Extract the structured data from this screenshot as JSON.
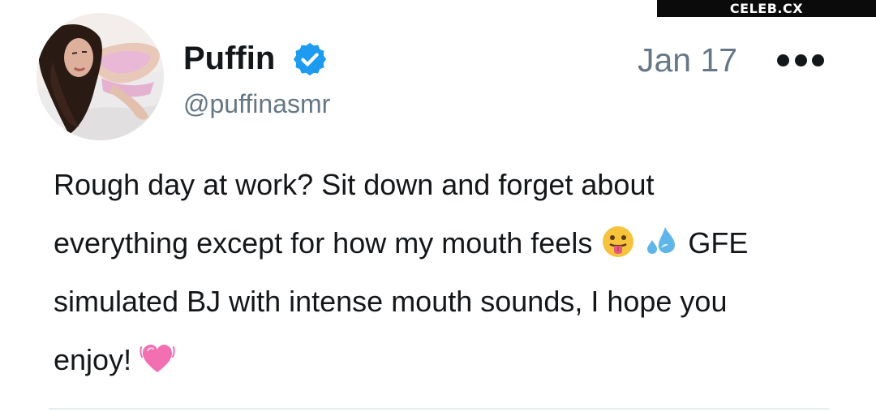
{
  "watermark": {
    "text": "CELEB.CX"
  },
  "author": {
    "display_name": "Puffin",
    "handle": "@puffinasmr",
    "verified": true,
    "avatar_icon": "profile-photo"
  },
  "meta": {
    "date": "Jan 17",
    "more_icon": "more-dots-icon"
  },
  "post": {
    "line1": "Rough day at work? Sit down and forget about",
    "line2_text": "everything except for how my mouth feels",
    "line2_emoji_1": "tongue-out-emoji",
    "line2_emoji_2": "sweat-droplets-emoji",
    "line2_tail": "GFE",
    "line3": "simulated BJ with intense mouth sounds, I hope you",
    "line4_text": "enjoy!",
    "line4_emoji": "beating-heart-emoji"
  },
  "colors": {
    "text": "#14171a",
    "secondary": "#657786",
    "verified_blue": "#1d9bf0",
    "watermark_bg": "#0b0b0b"
  }
}
